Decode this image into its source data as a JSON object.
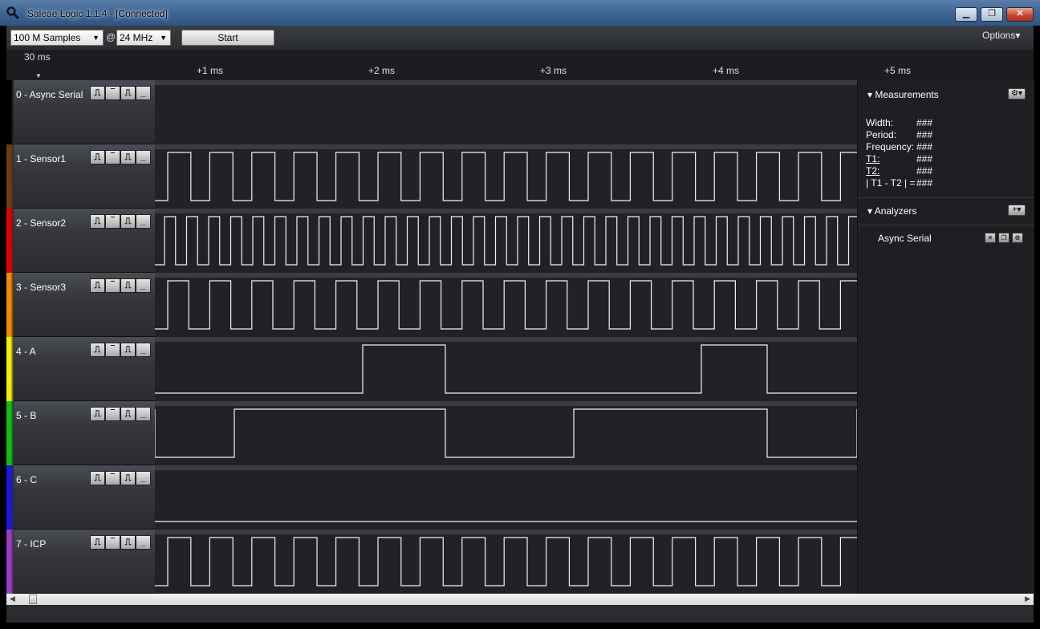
{
  "window": {
    "title": "Saleae Logic 1.1.4 - [Connected]"
  },
  "toolbar": {
    "samples": "100 M Samples",
    "at": "@",
    "rate": "24 MHz",
    "start_label": "Start",
    "options_label": "Options▾"
  },
  "ruler": {
    "start": "30 ms",
    "ticks": [
      "+1 ms",
      "+2 ms",
      "+3 ms",
      "+4 ms",
      "+5 ms"
    ]
  },
  "channels": [
    {
      "name": "0 - Async Serial",
      "color": "#000000"
    },
    {
      "name": "1 - Sensor1",
      "color": "#6b3d12"
    },
    {
      "name": "2 - Sensor2",
      "color": "#e00000"
    },
    {
      "name": "3 - Sensor3",
      "color": "#f08a00"
    },
    {
      "name": "4 - A",
      "color": "#f0f000"
    },
    {
      "name": "5 - B",
      "color": "#10c010"
    },
    {
      "name": "6 - C",
      "color": "#1818e0"
    },
    {
      "name": "7 - ICP",
      "color": "#9a3cc8"
    }
  ],
  "trigger_buttons": [
    "⎍",
    "‾",
    "⎍",
    "_"
  ],
  "measurements": {
    "title": "Measurements",
    "rows": [
      {
        "label": "Width:",
        "value": "###"
      },
      {
        "label": "Period:",
        "value": "###"
      },
      {
        "label": "Frequency:",
        "value": "###"
      },
      {
        "label": "T1:",
        "value": "###"
      },
      {
        "label": "T2:",
        "value": "###"
      },
      {
        "label": "| T1 - T2 | =",
        "value": "###"
      }
    ]
  },
  "analyzers": {
    "title": "Analyzers",
    "items": [
      {
        "name": "Async Serial"
      }
    ]
  }
}
